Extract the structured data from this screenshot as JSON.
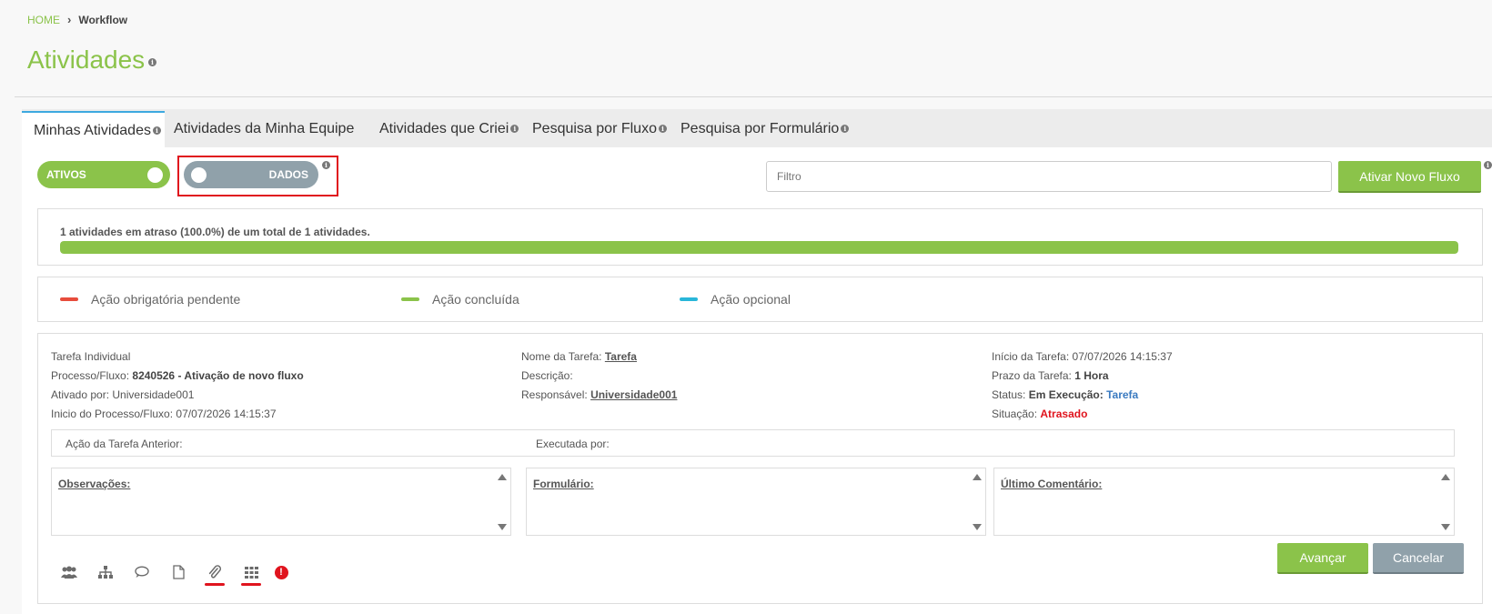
{
  "breadcrumb": {
    "home": "HOME",
    "separator": "›",
    "current": "Workflow"
  },
  "page": {
    "title": "Atividades",
    "info_glyph": "i"
  },
  "tabs": [
    {
      "label": "Minhas Atividades",
      "active": true,
      "info": true
    },
    {
      "label": "Atividades da Minha Equipe",
      "active": false,
      "info": false
    },
    {
      "label": "Atividades que Criei",
      "active": false,
      "info": true
    },
    {
      "label": "Pesquisa por Fluxo",
      "active": false,
      "info": true
    },
    {
      "label": "Pesquisa por Formulário",
      "active": false,
      "info": true
    }
  ],
  "toolbar": {
    "toggle_ativos": "ATIVOS",
    "toggle_dados": "DADOS",
    "filter_placeholder": "Filtro",
    "novo_fluxo": "Ativar Novo Fluxo"
  },
  "progress": {
    "text": "1 atividades em atraso (100.0%) de um total de 1 atividades.",
    "percent": 100
  },
  "legend": [
    {
      "label": "Ação obrigatória pendente",
      "color": "#e74c3c"
    },
    {
      "label": "Ação concluída",
      "color": "#8bc34a"
    },
    {
      "label": "Ação opcional",
      "color": "#29b6d9"
    }
  ],
  "task": {
    "type": "Tarefa Individual",
    "processo_label": "Processo/Fluxo:",
    "processo_value": "8240526 - Ativação de novo fluxo",
    "ativado_label": "Ativado por:",
    "ativado_value": "Universidade001",
    "inicio_processo_label": "Inicio do Processo/Fluxo:",
    "inicio_processo_value": "07/07/2026 14:15:37",
    "nome_label": "Nome da Tarefa:",
    "nome_value": "Tarefa",
    "descricao_label": "Descrição:",
    "responsavel_label": "Responsável:",
    "responsavel_value": "Universidade001",
    "inicio_tarefa_label": "Início da Tarefa:",
    "inicio_tarefa_value": "07/07/2026 14:15:37",
    "prazo_label": "Prazo da Tarefa:",
    "prazo_value": "1 Hora",
    "status_label": "Status:",
    "status_value": "Em Execução:",
    "status_task": "Tarefa",
    "situacao_label": "Situação:",
    "situacao_value": "Atrasado",
    "acao_anterior_label": "Ação da Tarefa Anterior:",
    "executada_label": "Executada por:",
    "observacoes_label": "Observações:",
    "formulario_label": "Formulário:",
    "comentario_label": "Último Comentário:",
    "alert_glyph": "!",
    "btn_avancar": "Avançar",
    "btn_cancelar": "Cancelar"
  },
  "colors": {
    "accent": "#8bc34a",
    "gray_toggle": "#90a1aa",
    "alert": "#e0141e",
    "tab_active": "#3da9e0"
  },
  "icons": [
    "users-icon",
    "sitemap-icon",
    "comment-icon",
    "document-icon",
    "paperclip-icon",
    "grid-icon",
    "alert-icon"
  ]
}
